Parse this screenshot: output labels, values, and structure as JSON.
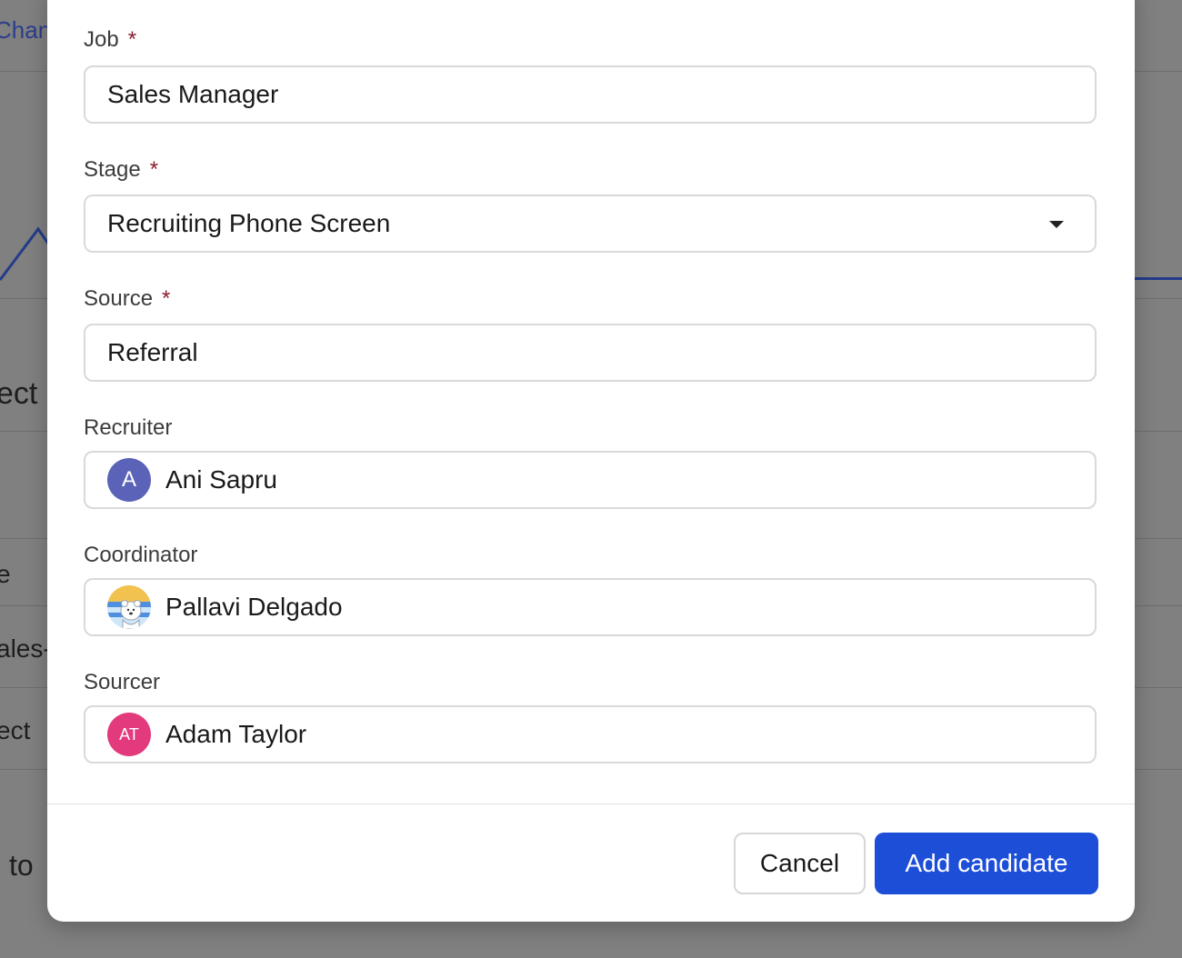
{
  "background": {
    "link_fragment": "Chan",
    "text_fragments": [
      "ect",
      "e",
      "ales-",
      "ect",
      "to"
    ]
  },
  "form": {
    "job": {
      "label": "Job",
      "required_mark": "*",
      "value": "Sales Manager"
    },
    "stage": {
      "label": "Stage",
      "required_mark": "*",
      "value": "Recruiting Phone Screen",
      "icon": "caret-down-icon"
    },
    "source": {
      "label": "Source",
      "required_mark": "*",
      "value": "Referral"
    },
    "recruiter": {
      "label": "Recruiter",
      "avatar_text": "A",
      "value": "Ani Sapru"
    },
    "coordinator": {
      "label": "Coordinator",
      "avatar_image": "polar-bear-avatar",
      "value": "Pallavi Delgado"
    },
    "sourcer": {
      "label": "Sourcer",
      "avatar_text": "AT",
      "value": "Adam Taylor"
    }
  },
  "footer": {
    "cancel_label": "Cancel",
    "submit_label": "Add candidate"
  },
  "colors": {
    "primary": "#1d4ed8",
    "required": "#8b1c2c",
    "avatar_a": "#5b63b8",
    "avatar_at": "#e23a7c"
  }
}
